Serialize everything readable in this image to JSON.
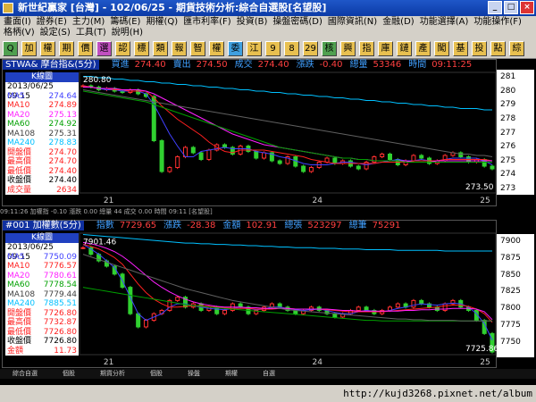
{
  "window": {
    "title": "新世紀贏家 [台灣] - 102/06/25 - 期貨技術分析:綜合自選股[名望股]"
  },
  "menu": {
    "row1": [
      "畫面(I)",
      "證券(E)",
      "主力(M)",
      "籌碼(E)",
      "期權(Q)",
      "匯市利率(F)",
      "投資(B)",
      "操盤密碼(D)",
      "國際資訊(N)",
      "金融(D)",
      "功能選擇(A)",
      "功能操作(F)"
    ],
    "row2": [
      "格柄(V)",
      "設定(S)",
      "工具(T)",
      "說明(H)"
    ]
  },
  "toolbar": {
    "buttons": [
      "Q",
      "加",
      "權",
      "期",
      "價",
      "選",
      "認",
      "標",
      "類",
      "報",
      "智",
      "權",
      "委",
      "江",
      "9",
      "8",
      "29",
      "核",
      "興",
      "指",
      "庫",
      "鏈",
      "產",
      "闖",
      "基",
      "投",
      "點",
      "綜"
    ]
  },
  "panel1": {
    "symbol": "STWA& 摩台指&(5分)",
    "quote": [
      {
        "label": "買進",
        "value": "274.40"
      },
      {
        "label": "賣出",
        "value": "274.50"
      },
      {
        "label": "成交",
        "value": "274.40"
      },
      {
        "label": "漲跌",
        "value": "-0.40"
      },
      {
        "label": "總量",
        "value": "53346"
      },
      {
        "label": "時間",
        "value": "09:11:25"
      }
    ],
    "legend_title": "K線圖",
    "legend_date": "2013/06/25 09:15",
    "legend_rows": [
      {
        "label": "MA5",
        "value": "274.64",
        "color": "#4040ff"
      },
      {
        "label": "MA10",
        "value": "274.89",
        "color": "#ff2020"
      },
      {
        "label": "MA20",
        "value": "275.13",
        "color": "#ff20ff"
      },
      {
        "label": "MA60",
        "value": "274.92",
        "color": "#00a000"
      },
      {
        "label": "MA108",
        "value": "275.31",
        "color": "#404040"
      },
      {
        "label": "MA240",
        "value": "278.83",
        "color": "#00c0ff"
      },
      {
        "label": "開盤價",
        "value": "274.70",
        "color": "#ff2020"
      },
      {
        "label": "最高價",
        "value": "274.70",
        "color": "#ff2020"
      },
      {
        "label": "最低價",
        "value": "274.40",
        "color": "#ff2020"
      },
      {
        "label": "收盤價",
        "value": "274.40",
        "color": "#000000"
      },
      {
        "label": "成交量",
        "value": "2634",
        "color": "#ff2020"
      }
    ],
    "hi_label": "280.80",
    "lo_label": "273.50",
    "y_ticks": [
      "281",
      "280",
      "279",
      "278",
      "277",
      "276",
      "275",
      "274",
      "273"
    ],
    "x_labels": [
      "21",
      "24",
      "25"
    ],
    "strip": "09:11:26 加權指 -0.10 漲跌 0.00 總量 44 成交 0.00 時間 09:11 [名望股]"
  },
  "panel2": {
    "symbol": "#001 加權數(5分)",
    "quote": [
      {
        "label": "指數",
        "value": "7729.65"
      },
      {
        "label": "漲跌",
        "value": "-28.38"
      },
      {
        "label": "金額",
        "value": "102.91"
      },
      {
        "label": "總張",
        "value": "523297"
      },
      {
        "label": "總筆",
        "value": "75291"
      }
    ],
    "legend_title": "K線圖",
    "legend_date": "2013/06/25 09:15",
    "legend_rows": [
      {
        "label": "MA5",
        "value": "7750.09",
        "color": "#4040ff"
      },
      {
        "label": "MA10",
        "value": "7776.57",
        "color": "#ff2020"
      },
      {
        "label": "MA20",
        "value": "7780.61",
        "color": "#ff20ff"
      },
      {
        "label": "MA60",
        "value": "7778.54",
        "color": "#00a000"
      },
      {
        "label": "MA108",
        "value": "7779.44",
        "color": "#404040"
      },
      {
        "label": "MA240",
        "value": "7885.51",
        "color": "#00c0ff"
      },
      {
        "label": "開盤價",
        "value": "7726.80",
        "color": "#ff2020"
      },
      {
        "label": "最高價",
        "value": "7732.87",
        "color": "#ff2020"
      },
      {
        "label": "最低價",
        "value": "7726.80",
        "color": "#ff2020"
      },
      {
        "label": "收盤價",
        "value": "7726.80",
        "color": "#000000"
      },
      {
        "label": "金額",
        "value": "11.73",
        "color": "#ff2020"
      }
    ],
    "hi_label": "7901.46",
    "lo_label": "7725.86",
    "y_ticks": [
      "7900",
      "7875",
      "7850",
      "7825",
      "7800",
      "7775",
      "7750"
    ],
    "x_labels": [
      "21",
      "24",
      "25"
    ],
    "strip": "09:11:26 加權指 -0.10 漲跌 0.00 總量 44 成交 0.00 時間 09:11 [名望股]"
  },
  "status": {
    "url": "http://kujd3268.pixnet.net/album",
    "tabs": [
      "綜合自選",
      "個股",
      "期貨分析",
      "個股",
      "操盤",
      "期權",
      "自選"
    ]
  },
  "chart_data": [
    {
      "type": "candlestick",
      "title": "STWA& 摩台指&(5分)",
      "ylim": [
        272.6,
        281.6
      ],
      "y_ticks": [
        273,
        274,
        275,
        276,
        277,
        278,
        279,
        280,
        281
      ],
      "x_labels": [
        "21",
        "24",
        "25"
      ],
      "close": [
        280.6,
        280.5,
        280.3,
        280.4,
        280.2,
        280.1,
        280.3,
        280.0,
        279.8,
        276.5,
        274.2,
        274.5,
        275.3,
        276.0,
        275.6,
        275.1,
        275.8,
        276.2,
        276.0,
        275.5,
        276.1,
        275.7,
        275.2,
        275.6,
        275.0,
        274.8,
        275.3,
        274.6,
        274.2,
        274.5,
        274.9,
        275.2,
        274.8,
        275.0,
        274.6,
        274.4,
        274.9,
        275.3,
        275.5,
        275.1,
        274.7,
        275.0,
        275.4,
        275.2,
        274.8,
        275.0,
        275.4,
        275.6,
        275.3,
        274.9,
        275.1,
        274.6,
        274.4
      ],
      "series": [
        {
          "name": "MA5",
          "values": [
            280.6,
            280.5,
            280.4,
            280.3,
            280.3,
            280.2,
            280.2,
            280.2,
            280.0,
            279.2,
            278.1,
            277.0,
            276.1,
            275.3,
            275.3,
            275.7,
            275.8,
            275.9,
            276.0,
            275.9,
            275.9,
            275.9,
            275.7,
            275.6,
            275.5,
            275.3,
            275.2,
            275.0,
            274.8,
            274.7,
            274.7,
            274.7,
            274.8,
            274.9,
            274.9,
            274.8,
            274.7,
            274.8,
            274.9,
            275.0,
            275.1,
            275.0,
            275.0,
            275.1,
            275.0,
            275.0,
            275.1,
            275.2,
            275.2,
            275.2,
            275.2,
            275.0,
            274.7
          ]
        },
        {
          "name": "MA10",
          "values": [
            280.6,
            280.5,
            280.4,
            280.4,
            280.3,
            280.3,
            280.2,
            280.2,
            280.2,
            279.7,
            279.1,
            278.6,
            278.1,
            277.7,
            277.3,
            276.9,
            276.4,
            276.0,
            275.7,
            275.6,
            275.8,
            275.8,
            275.8,
            275.8,
            275.7,
            275.6,
            275.5,
            275.4,
            275.3,
            275.1,
            275.0,
            274.9,
            274.8,
            274.8,
            274.8,
            274.8,
            274.8,
            274.8,
            274.9,
            274.9,
            274.9,
            274.9,
            275.0,
            275.0,
            275.0,
            275.0,
            275.1,
            275.1,
            275.1,
            275.1,
            275.1,
            275.1,
            275.0
          ]
        },
        {
          "name": "MA20",
          "values": [
            280.5,
            280.5,
            280.4,
            280.4,
            280.4,
            280.3,
            280.3,
            280.3,
            280.2,
            280.0,
            279.7,
            279.4,
            279.1,
            278.8,
            278.5,
            278.2,
            277.9,
            277.6,
            277.3,
            277.0,
            276.8,
            276.6,
            276.4,
            276.2,
            276.1,
            276.0,
            275.9,
            275.8,
            275.7,
            275.6,
            275.5,
            275.4,
            275.3,
            275.2,
            275.2,
            275.1,
            275.1,
            275.0,
            275.0,
            275.0,
            275.0,
            275.0,
            274.9,
            274.9,
            274.9,
            275.0,
            275.0,
            275.0,
            275.0,
            275.0,
            275.0,
            275.0,
            275.0
          ]
        },
        {
          "name": "MA60",
          "values": [
            280.2,
            280.1,
            280.0,
            279.9,
            279.8,
            279.7,
            279.6,
            279.5,
            279.4,
            279.2,
            279.0,
            278.8,
            278.6,
            278.4,
            278.2,
            278.0,
            277.8,
            277.6,
            277.4,
            277.2,
            277.0,
            276.8,
            276.6,
            276.4,
            276.2,
            276.0,
            275.9,
            275.8,
            275.7,
            275.6,
            275.5,
            275.4,
            275.3,
            275.2,
            275.2,
            275.1,
            275.1,
            275.0,
            275.0,
            275.0,
            275.0,
            274.9,
            274.9,
            274.9,
            274.9,
            274.9,
            274.9,
            274.9,
            274.9,
            274.9,
            274.9,
            274.9,
            274.9
          ]
        },
        {
          "name": "MA108",
          "values": [
            280.3,
            280.2,
            280.1,
            280.0,
            279.9,
            279.8,
            279.7,
            279.6,
            279.5,
            279.4,
            279.3,
            279.2,
            279.1,
            279.0,
            278.9,
            278.8,
            278.7,
            278.6,
            278.5,
            278.4,
            278.3,
            278.2,
            278.1,
            278.0,
            277.9,
            277.8,
            277.7,
            277.6,
            277.5,
            277.4,
            277.3,
            277.2,
            277.1,
            277.0,
            276.9,
            276.8,
            276.7,
            276.6,
            276.5,
            276.4,
            276.3,
            276.2,
            276.1,
            276.0,
            275.9,
            275.8,
            275.7,
            275.6,
            275.5,
            275.5,
            275.4,
            275.4,
            275.3
          ]
        },
        {
          "name": "MA240",
          "values": [
            281.3,
            281.3,
            281.2,
            281.2,
            281.1,
            281.1,
            281.0,
            281.0,
            280.9,
            280.9,
            280.8,
            280.8,
            280.7,
            280.7,
            280.6,
            280.6,
            280.5,
            280.5,
            280.4,
            280.4,
            280.3,
            280.3,
            280.2,
            280.2,
            280.1,
            280.1,
            280.0,
            280.0,
            279.9,
            279.9,
            279.8,
            279.8,
            279.7,
            279.7,
            279.6,
            279.6,
            279.5,
            279.5,
            279.4,
            279.4,
            279.3,
            279.3,
            279.2,
            279.2,
            279.1,
            279.1,
            279.0,
            279.0,
            278.9,
            278.9,
            278.9,
            278.8,
            278.8
          ]
        }
      ]
    },
    {
      "type": "candlestick",
      "title": "#001 加權數(5分)",
      "ylim": [
        7728,
        7912
      ],
      "y_ticks": [
        7750,
        7775,
        7800,
        7825,
        7850,
        7875,
        7900
      ],
      "x_labels": [
        "21",
        "24",
        "25"
      ],
      "close": [
        7890,
        7880,
        7870,
        7862,
        7850,
        7830,
        7790,
        7770,
        7780,
        7790,
        7795,
        7810,
        7815,
        7800,
        7805,
        7795,
        7800,
        7790,
        7795,
        7805,
        7800,
        7790,
        7795,
        7800,
        7805,
        7800,
        7795,
        7790,
        7795,
        7800,
        7795,
        7790,
        7785,
        7790,
        7795,
        7800,
        7795,
        7790,
        7795,
        7800,
        7805,
        7800,
        7810,
        7805,
        7800,
        7795,
        7805,
        7810,
        7800,
        7795,
        7780,
        7760,
        7732
      ],
      "series": [
        {
          "name": "MA5",
          "values": [
            7895,
            7888,
            7880,
            7870,
            7860,
            7840,
            7815,
            7790,
            7780,
            7785,
            7790,
            7800,
            7805,
            7805,
            7802,
            7800,
            7798,
            7797,
            7796,
            7798,
            7800,
            7798,
            7796,
            7797,
            7800,
            7800,
            7798,
            7796,
            7795,
            7796,
            7797,
            7795,
            7792,
            7790,
            7790,
            7793,
            7795,
            7794,
            7793,
            7795,
            7798,
            7800,
            7803,
            7805,
            7804,
            7803,
            7805,
            7806,
            7805,
            7800,
            7790,
            7775,
            7750
          ]
        },
        {
          "name": "MA10",
          "values": [
            7895,
            7892,
            7888,
            7882,
            7875,
            7865,
            7850,
            7835,
            7822,
            7812,
            7805,
            7800,
            7800,
            7801,
            7802,
            7802,
            7801,
            7800,
            7799,
            7798,
            7798,
            7798,
            7797,
            7797,
            7797,
            7798,
            7798,
            7797,
            7797,
            7797,
            7797,
            7796,
            7795,
            7794,
            7793,
            7793,
            7793,
            7793,
            7793,
            7794,
            7795,
            7796,
            7797,
            7798,
            7799,
            7800,
            7802,
            7803,
            7803,
            7801,
            7797,
            7790,
            7777
          ]
        },
        {
          "name": "MA20",
          "values": [
            7898,
            7896,
            7893,
            7889,
            7884,
            7877,
            7868,
            7858,
            7848,
            7838,
            7830,
            7823,
            7817,
            7812,
            7808,
            7805,
            7803,
            7801,
            7800,
            7800,
            7800,
            7799,
            7799,
            7798,
            7798,
            7798,
            7798,
            7797,
            7797,
            7797,
            7797,
            7797,
            7796,
            7795,
            7795,
            7794,
            7794,
            7794,
            7794,
            7794,
            7794,
            7795,
            7795,
            7796,
            7796,
            7797,
            7797,
            7798,
            7798,
            7798,
            7797,
            7793,
            7781
          ]
        },
        {
          "name": "MA60",
          "values": [
            7830,
            7828,
            7826,
            7824,
            7822,
            7820,
            7818,
            7816,
            7814,
            7812,
            7810,
            7808,
            7806,
            7804,
            7802,
            7801,
            7800,
            7799,
            7798,
            7797,
            7796,
            7795,
            7794,
            7793,
            7792,
            7791,
            7790,
            7789,
            7788,
            7787,
            7786,
            7785,
            7784,
            7783,
            7782,
            7781,
            7780,
            7780,
            7779,
            7779,
            7779,
            7779,
            7779,
            7779,
            7779,
            7779,
            7779,
            7779,
            7779,
            7779,
            7779,
            7779,
            7779
          ]
        },
        {
          "name": "MA108",
          "values": [
            7880,
            7876,
            7872,
            7868,
            7864,
            7860,
            7856,
            7852,
            7848,
            7844,
            7840,
            7836,
            7832,
            7828,
            7825,
            7822,
            7819,
            7816,
            7813,
            7810,
            7808,
            7806,
            7804,
            7802,
            7800,
            7798,
            7796,
            7795,
            7794,
            7793,
            7792,
            7791,
            7790,
            7789,
            7788,
            7787,
            7786,
            7785,
            7784,
            7783,
            7782,
            7782,
            7781,
            7781,
            7780,
            7780,
            7780,
            7780,
            7779,
            7779,
            7779,
            7779,
            7779
          ]
        },
        {
          "name": "MA240",
          "values": [
            7910,
            7909,
            7908,
            7907,
            7906,
            7905,
            7904,
            7903,
            7902,
            7901,
            7900,
            7899,
            7898,
            7897,
            7897,
            7896,
            7896,
            7895,
            7895,
            7894,
            7894,
            7893,
            7893,
            7892,
            7892,
            7891,
            7891,
            7890,
            7890,
            7890,
            7889,
            7889,
            7889,
            7888,
            7888,
            7888,
            7887,
            7887,
            7887,
            7887,
            7886,
            7886,
            7886,
            7886,
            7886,
            7886,
            7885,
            7885,
            7885,
            7885,
            7885,
            7885,
            7885
          ]
        }
      ]
    }
  ]
}
